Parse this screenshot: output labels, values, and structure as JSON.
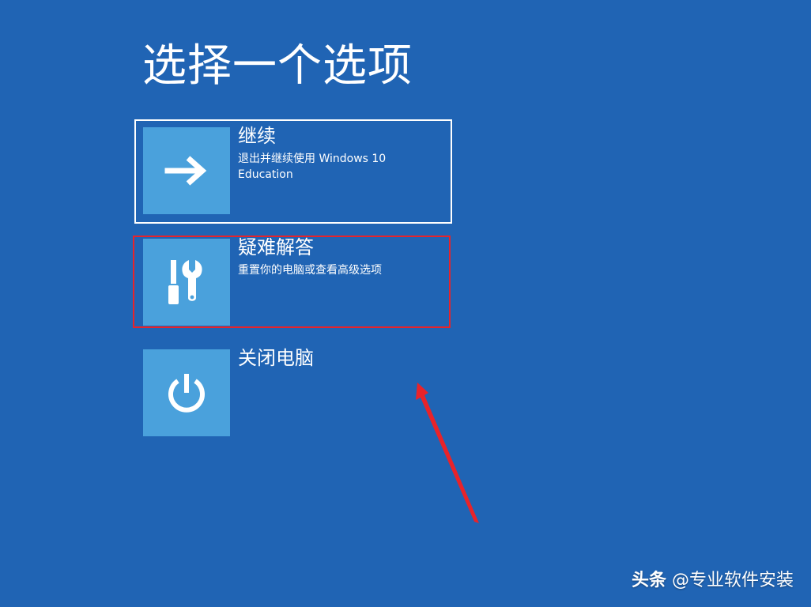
{
  "page": {
    "title": "选择一个选项"
  },
  "options": [
    {
      "title": "继续",
      "description": "退出并继续使用 Windows 10 Education",
      "icon": "arrow-right-icon"
    },
    {
      "title": "疑难解答",
      "description": "重置你的电脑或查看高级选项",
      "icon": "tools-icon"
    },
    {
      "title": "关闭电脑",
      "description": "",
      "icon": "power-icon"
    }
  ],
  "watermark": {
    "brand": "头条",
    "handle": "@专业软件安装"
  },
  "colors": {
    "background": "#2064b4",
    "tile": "#4aa1dc",
    "annotation": "#e8232a"
  }
}
